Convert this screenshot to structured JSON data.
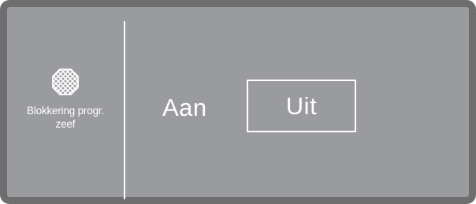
{
  "sidebar": {
    "icon": "sieve-icon",
    "label_line1": "Blokkering progr.",
    "label_line2": "zeef"
  },
  "options": {
    "on_label": "Aan",
    "off_label": "Uit",
    "selected": "off"
  },
  "colors": {
    "screen_background": "#9a9b9f",
    "bezel": "#6e6e6e",
    "foreground": "#ffffff"
  }
}
